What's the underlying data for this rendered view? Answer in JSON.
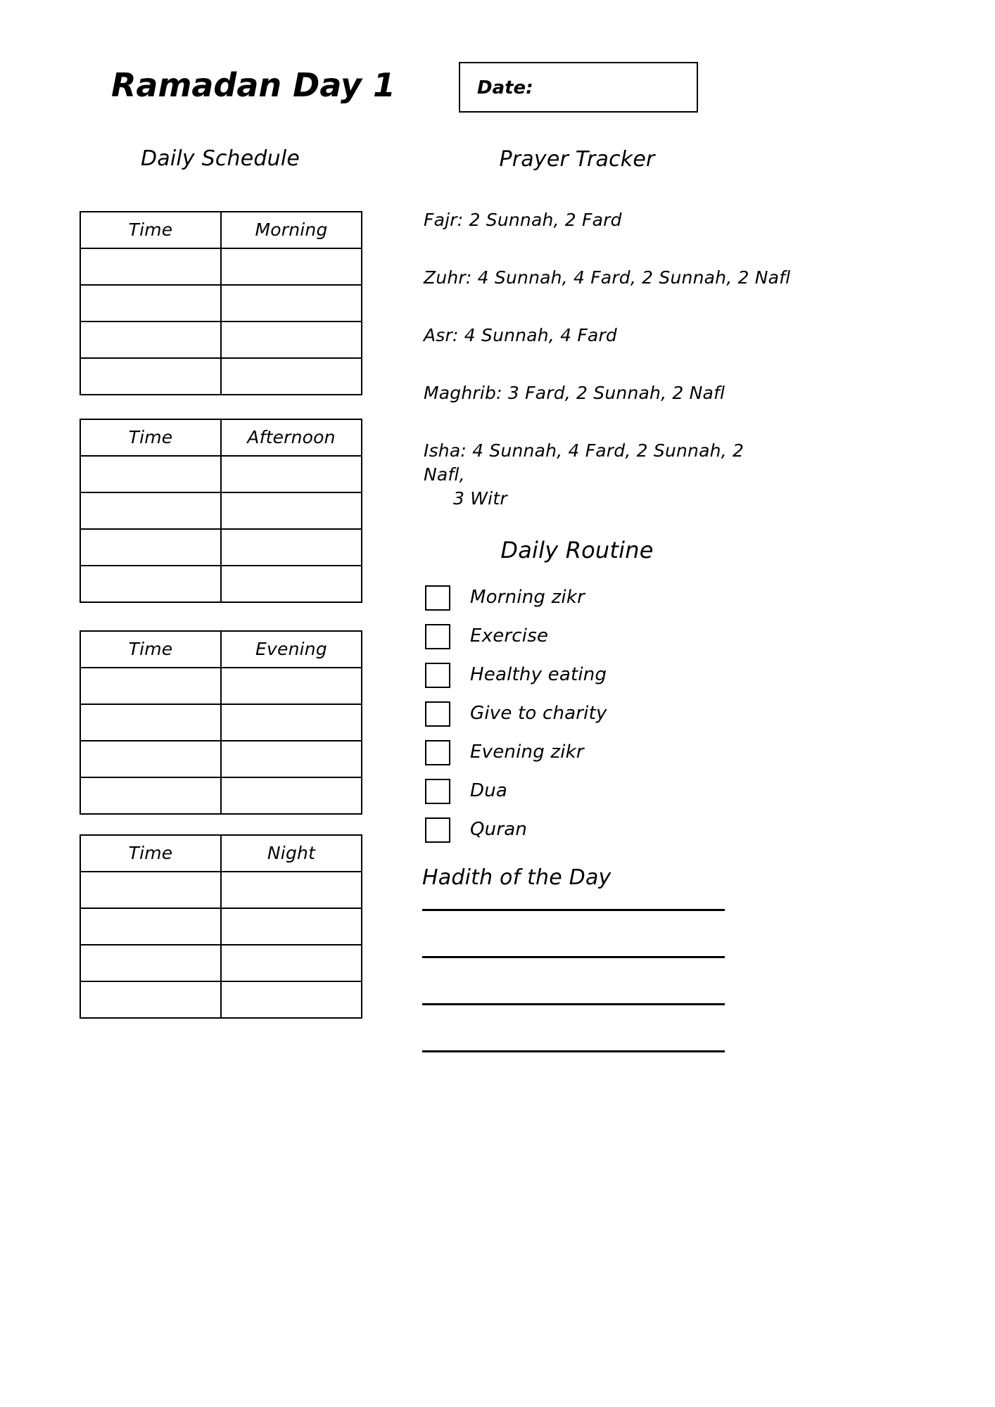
{
  "page": {
    "title": "Ramadan Day 1",
    "background_color": "#ffffff",
    "ink_color": "#000000"
  },
  "header": {
    "title": "Ramadan Day 1",
    "date_label": "Date:",
    "date_value": ""
  },
  "schedule": {
    "heading": "Daily Schedule",
    "time_column_header": "Time",
    "tables": [
      {
        "headers": [
          "Time",
          "Morning"
        ],
        "rows": [
          [
            "",
            ""
          ],
          [
            "",
            ""
          ],
          [
            "",
            ""
          ],
          [
            "",
            ""
          ]
        ]
      },
      {
        "headers": [
          "Time",
          "Afternoon"
        ],
        "rows": [
          [
            "",
            ""
          ],
          [
            "",
            ""
          ],
          [
            "",
            ""
          ],
          [
            "",
            ""
          ]
        ]
      },
      {
        "headers": [
          "Time",
          "Evening"
        ],
        "rows": [
          [
            "",
            ""
          ],
          [
            "",
            ""
          ],
          [
            "",
            ""
          ],
          [
            "",
            ""
          ]
        ]
      },
      {
        "headers": [
          "Time",
          "Night"
        ],
        "rows": [
          [
            "",
            ""
          ],
          [
            "",
            ""
          ],
          [
            "",
            ""
          ],
          [
            "",
            ""
          ]
        ]
      }
    ]
  },
  "prayer_tracker": {
    "heading": "Prayer Tracker",
    "entries": [
      {
        "text": "Fajr: 2 Sunnah, 2 Fard",
        "continuation": ""
      },
      {
        "text": "Zuhr: 4 Sunnah, 4 Fard, 2 Sunnah, 2 Nafl",
        "continuation": ""
      },
      {
        "text": "Asr: 4 Sunnah, 4 Fard",
        "continuation": ""
      },
      {
        "text": "Maghrib: 3 Fard, 2 Sunnah, 2 Nafl",
        "continuation": ""
      },
      {
        "text": "Isha: 4 Sunnah, 4 Fard, 2 Sunnah, 2 Nafl,",
        "continuation": "3 Witr"
      }
    ]
  },
  "daily_routine": {
    "heading": "Daily Routine",
    "items": [
      {
        "label": "Morning zikr",
        "checked": false
      },
      {
        "label": "Exercise",
        "checked": false
      },
      {
        "label": "Healthy eating",
        "checked": false
      },
      {
        "label": "Give to charity",
        "checked": false
      },
      {
        "label": "Evening zikr",
        "checked": false
      },
      {
        "label": "Dua",
        "checked": false
      },
      {
        "label": "Quran",
        "checked": false
      }
    ]
  },
  "hadith": {
    "heading": "Hadith of the Day",
    "lines": [
      "",
      "",
      "",
      ""
    ]
  }
}
